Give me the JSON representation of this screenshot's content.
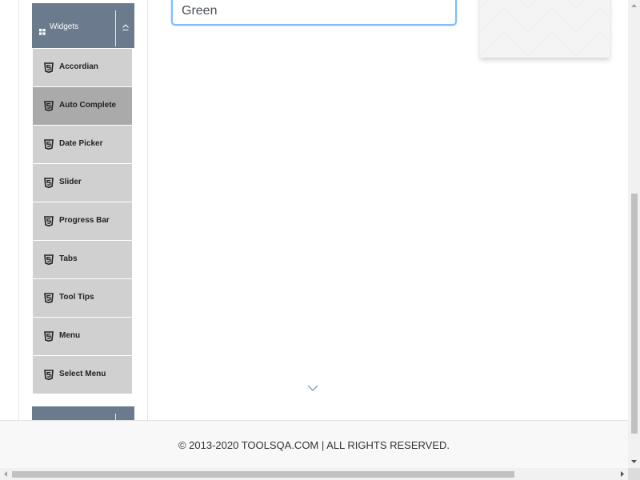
{
  "sidebar": {
    "widgets_group": {
      "title": "Widgets",
      "icon": "grid-icon",
      "toggle_icon": "collapse-up-icon"
    },
    "items": [
      {
        "label": "Accordian",
        "icon": "html5-icon",
        "active": false
      },
      {
        "label": "Auto Complete",
        "icon": "html5-icon",
        "active": true
      },
      {
        "label": "Date Picker",
        "icon": "html5-icon",
        "active": false
      },
      {
        "label": "Slider",
        "icon": "html5-icon",
        "active": false
      },
      {
        "label": "Progress Bar",
        "icon": "html5-icon",
        "active": false
      },
      {
        "label": "Tabs",
        "icon": "html5-icon",
        "active": false
      },
      {
        "label": "Tool Tips",
        "icon": "html5-icon",
        "active": false
      },
      {
        "label": "Menu",
        "icon": "html5-icon",
        "active": false
      },
      {
        "label": "Select Menu",
        "icon": "html5-icon",
        "active": false
      }
    ],
    "next_group": {
      "title": ""
    }
  },
  "main": {
    "autocomplete_input": {
      "value": "Green"
    }
  },
  "footer": {
    "copyright": "© 2013-2020 TOOLSQA.COM | ALL RIGHTS RESERVED."
  },
  "colors": {
    "group_header": "#6c7a8d",
    "menu_item": "#d0d0d0",
    "menu_item_active": "#aaaaaa",
    "input_focus_border": "#80bdff"
  }
}
